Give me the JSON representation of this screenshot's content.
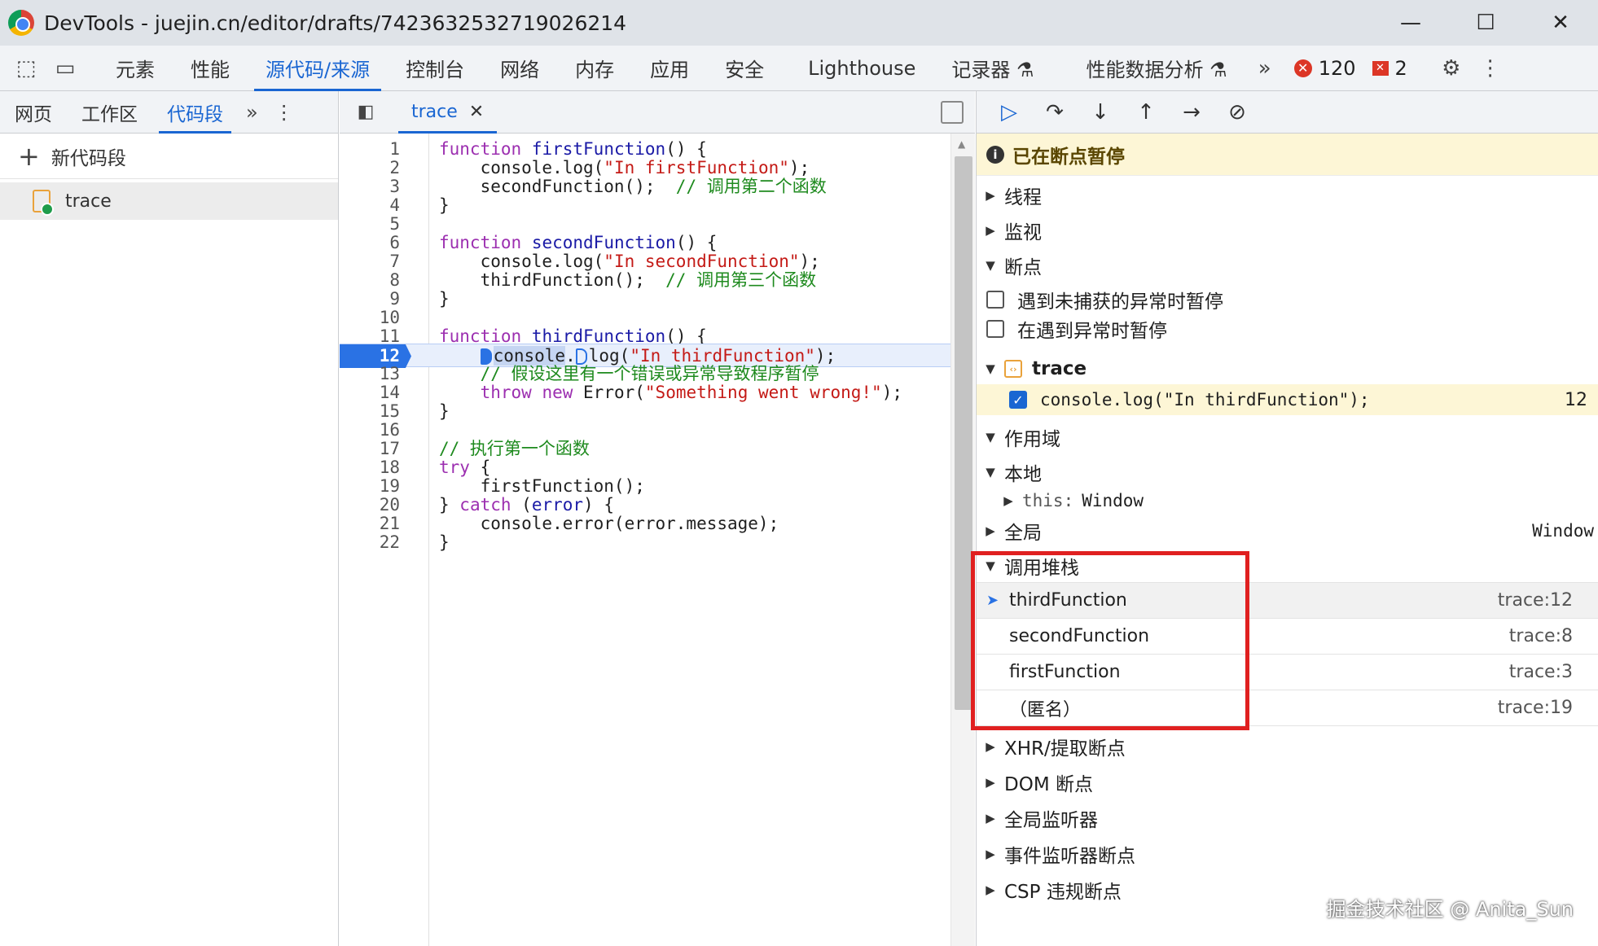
{
  "window": {
    "title": "DevTools - juejin.cn/editor/drafts/7423632532719026214",
    "minimize": "—",
    "maximize": "☐",
    "close": "✕"
  },
  "main_tabs": {
    "items": [
      "元素",
      "性能",
      "源代码/来源",
      "控制台",
      "网络",
      "内存",
      "应用",
      "安全",
      "Lighthouse",
      "记录器 ⚗",
      "性能数据分析 ⚗"
    ],
    "active": "源代码/来源",
    "more": "»",
    "error_count": "120",
    "warning_count": "2"
  },
  "navigator": {
    "tabs": [
      "网页",
      "工作区",
      "代码段"
    ],
    "active": "代码段",
    "new_snippet": "新代码段",
    "snippets": [
      "trace"
    ]
  },
  "editor": {
    "tab_name": "trace",
    "paused_line": 12,
    "lines": [
      {
        "n": "1"
      },
      {
        "n": "2"
      },
      {
        "n": "3"
      },
      {
        "n": "4"
      },
      {
        "n": "5"
      },
      {
        "n": "6"
      },
      {
        "n": "7"
      },
      {
        "n": "8"
      },
      {
        "n": "9"
      },
      {
        "n": "10"
      },
      {
        "n": "11"
      },
      {
        "n": "12"
      },
      {
        "n": "13"
      },
      {
        "n": "14"
      },
      {
        "n": "15"
      },
      {
        "n": "16"
      },
      {
        "n": "17"
      },
      {
        "n": "18"
      },
      {
        "n": "19"
      },
      {
        "n": "20"
      },
      {
        "n": "21"
      },
      {
        "n": "22"
      }
    ]
  },
  "debugger": {
    "paused_text": "已在断点暂停",
    "sections": {
      "threads": "线程",
      "watch": "监视",
      "breakpoints": "断点",
      "pause_uncaught": "遇到未捕获的异常时暂停",
      "pause_caught": "在遇到异常时暂停",
      "bp_file": "trace",
      "bp_code": "console.log(\"In thirdFunction\");",
      "bp_line": "12",
      "scope": "作用域",
      "local": "本地",
      "this_label": "this:",
      "this_value": "Window",
      "global": "全局",
      "global_value": "Window",
      "call_stack": "调用堆栈",
      "xhr": "XHR/提取断点",
      "dom": "DOM 断点",
      "global_listeners": "全局监听器",
      "event_listeners": "事件监听器断点",
      "csp": "CSP 违规断点"
    },
    "call_stack": [
      {
        "name": "thirdFunction",
        "loc": "trace:12"
      },
      {
        "name": "secondFunction",
        "loc": "trace:8"
      },
      {
        "name": "firstFunction",
        "loc": "trace:3"
      },
      {
        "name": "（匿名）",
        "loc": "trace:19"
      }
    ]
  },
  "watermark": "掘金技术社区 @ Anita_Sun",
  "colors": {
    "accent": "#1a66d2",
    "highlight_box": "#e02020",
    "paused_banner": "#fdf6d6"
  }
}
